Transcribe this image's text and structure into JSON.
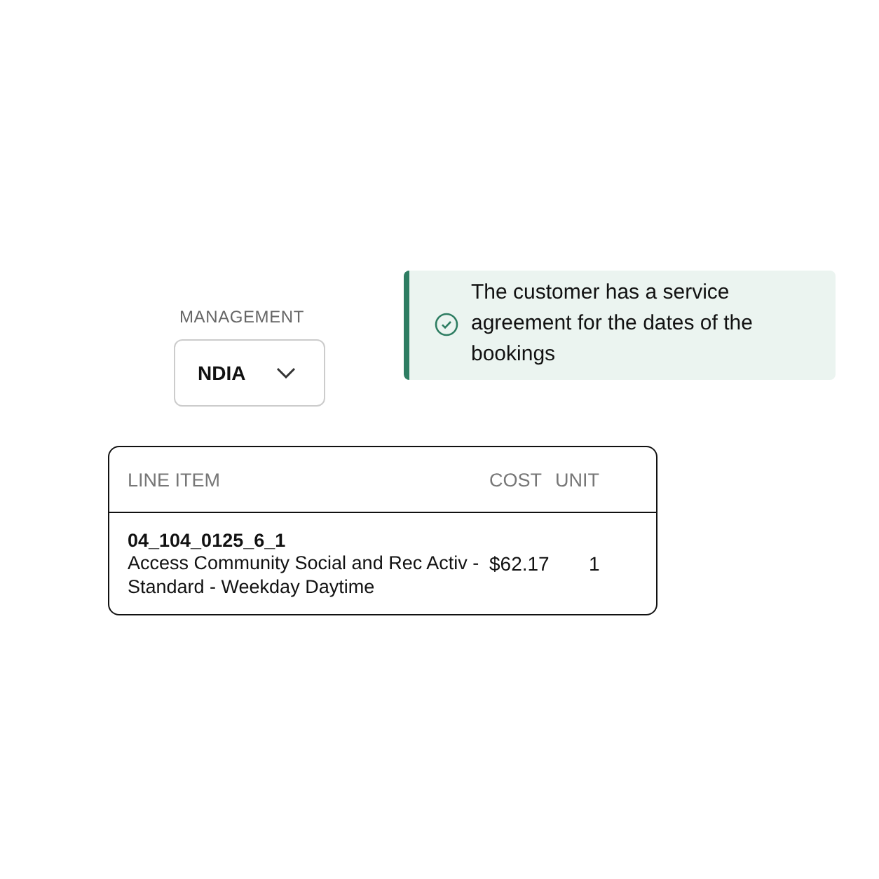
{
  "management": {
    "label": "MANAGEMENT",
    "value": "NDIA"
  },
  "alert": {
    "kind": "success",
    "message": "The customer has a service agreement for the dates of the bookings"
  },
  "table": {
    "columns": [
      "LINE ITEM",
      "COST",
      "UNIT"
    ],
    "rows": [
      {
        "code": "04_104_0125_6_1",
        "description": "Access Community Social and Rec Activ - Standard - Weekday Daytime",
        "cost": "$62.17",
        "unit": "1"
      }
    ]
  }
}
